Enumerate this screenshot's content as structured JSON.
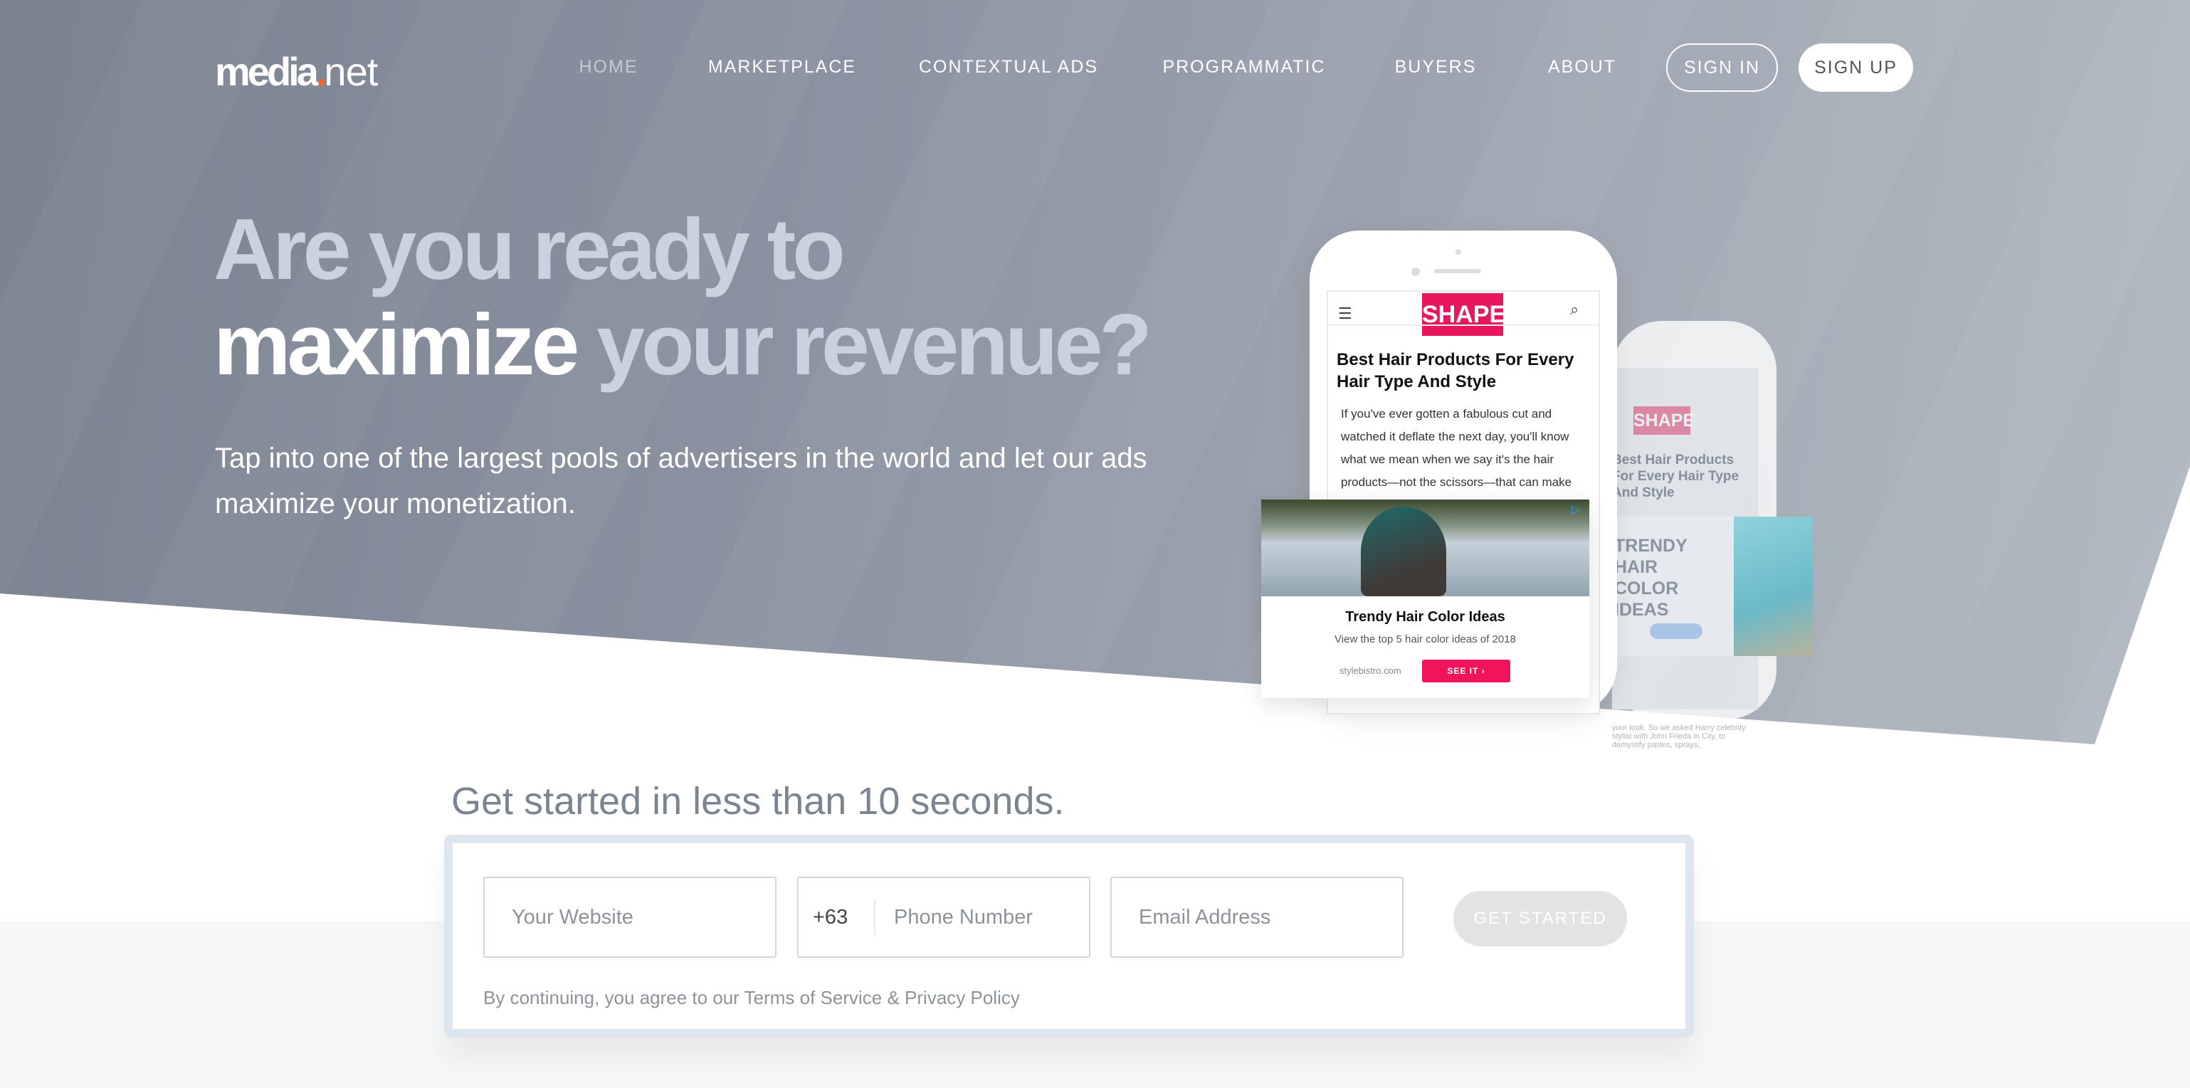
{
  "brand": {
    "logo_main": "media",
    "logo_dot": ".",
    "logo_tld": "net",
    "accent": "#f26522"
  },
  "nav": {
    "items": [
      "HOME",
      "MARKETPLACE",
      "CONTEXTUAL ADS",
      "PROGRAMMATIC",
      "BUYERS",
      "ABOUT"
    ],
    "sign_in": "SIGN IN",
    "sign_up": "SIGN UP"
  },
  "hero": {
    "line1": "Are you ready to",
    "line2_white": "maximize",
    "line2_rest": " your revenue?",
    "subtitle": "Tap into one of the largest pools of advertisers in the world and let our ads maximize your monetization."
  },
  "mockup": {
    "site_logo": "SHAPE",
    "article_title": "Best Hair Products For Every Hair Type And Style",
    "article_body": "If you've ever gotten a fabulous cut and watched it deflate the next day, you'll know what we mean when we say it's the hair products—not the scissors—that can make",
    "ad_title": "Trendy Hair Color Ideas",
    "ad_desc": "View the top 5 hair color ideas of 2018",
    "ad_domain": "stylebistro.com",
    "ad_cta": "SEE IT ›",
    "back_ad_title": "TRENDY HAIR COLOR IDEAS",
    "back_body": "your look. So we asked Harry celebrity stylist with John Frieda in City, to demystify pastes, sprays,",
    "brand_pink": "#e8175d"
  },
  "signup": {
    "heading": "Get started in less than 10 seconds.",
    "website_placeholder": "Your Website",
    "phone_code": "+63",
    "phone_placeholder": "Phone Number",
    "email_placeholder": "Email Address",
    "button": "GET STARTED",
    "terms": "By continuing, you agree to our Terms of Service & Privacy Policy"
  }
}
